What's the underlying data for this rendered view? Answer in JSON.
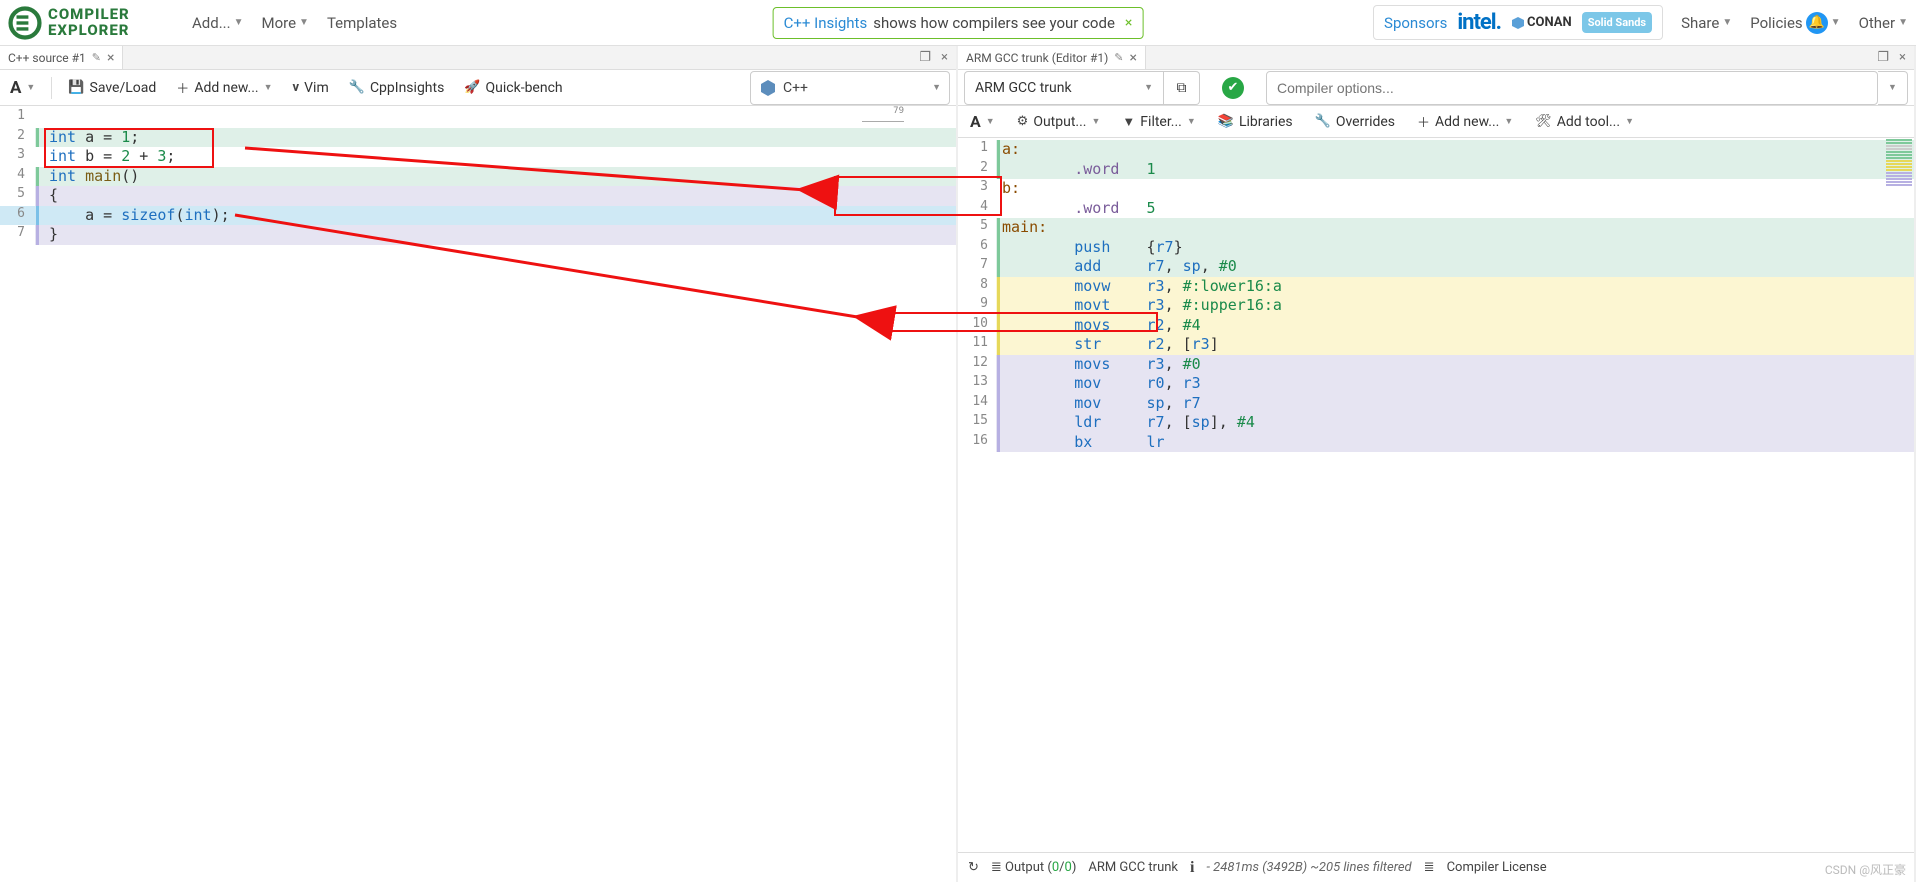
{
  "brand": {
    "line1": "COMPILER",
    "line2": "EXPLORER"
  },
  "nav": {
    "add": "Add...",
    "more": "More",
    "templates": "Templates"
  },
  "banner": {
    "link": "C++ Insights",
    "text": " shows how compilers see your code"
  },
  "navright": {
    "sponsors": "Sponsors",
    "share": "Share",
    "policies": "Policies",
    "other": "Other"
  },
  "sponsor_names": {
    "intel": "intel.",
    "conan": "CONAN",
    "ss": "Solid Sands"
  },
  "left": {
    "tab": "C++ source #1",
    "toolbar": {
      "save": "Save/Load",
      "addnew": "Add new...",
      "vim": "Vim",
      "cpp": "CppInsights",
      "qb": "Quick-bench"
    },
    "lang": "C++",
    "lines": [
      "1",
      "2",
      "3",
      "4",
      "5",
      "6",
      "7"
    ],
    "ruler": "79"
  },
  "src": {
    "l2_kw": "int",
    "l2_rest": " a = ",
    "l2_num": "1",
    "l2_semi": ";",
    "l3_kw": "int",
    "l3_rest": " b = ",
    "l3_n1": "2",
    "l3_plus": " + ",
    "l3_n2": "3",
    "l3_semi": ";",
    "l4_kw": "int",
    "l4_sp": " ",
    "l4_fn": "main",
    "l4_par": "()",
    "l5": "{",
    "l6_ind": "    ",
    "l6_a": "a",
    "l6_eq": " = ",
    "l6_sz": "sizeof",
    "l6_p1": "(",
    "l6_int": "int",
    "l6_p2": ")",
    "l6_semi": ";",
    "l7": "}"
  },
  "right": {
    "tab": "ARM GCC trunk (Editor #1)",
    "compiler": "ARM GCC trunk",
    "opts_ph": "Compiler options...",
    "subtb": {
      "output": "Output...",
      "filter": "Filter...",
      "libs": "Libraries",
      "over": "Overrides",
      "addnew": "Add new...",
      "addtool": "Add tool..."
    },
    "lines": [
      "1",
      "2",
      "3",
      "4",
      "5",
      "6",
      "7",
      "8",
      "9",
      "10",
      "11",
      "12",
      "13",
      "14",
      "15",
      "16"
    ]
  },
  "asm": {
    "l1": "a:",
    "l2i": "        ",
    "l2d": ".word",
    "l2s": "   ",
    "l2v": "1",
    "l3": "b:",
    "l4i": "        ",
    "l4d": ".word",
    "l4s": "   ",
    "l4v": "5",
    "l5": "main:",
    "l6i": "        ",
    "l6op": "push",
    "l6s": "    ",
    "l6p1": "{",
    "l6r": "r7",
    "l6p2": "}",
    "l7i": "        ",
    "l7op": "add",
    "l7s": "     ",
    "l7r1": "r7",
    "l7c": ", ",
    "l7r2": "sp",
    "l7c2": ", ",
    "l7imm": "#0",
    "l8i": "        ",
    "l8op": "movw",
    "l8s": "    ",
    "l8r": "r3",
    "l8c": ", ",
    "l8i2": "#:lower16:a",
    "l9i": "        ",
    "l9op": "movt",
    "l9s": "    ",
    "l9r": "r3",
    "l9c": ", ",
    "l9i2": "#:upper16:a",
    "l10i": "        ",
    "l10op": "movs",
    "l10s": "    ",
    "l10r": "r2",
    "l10c": ", ",
    "l10imm": "#4",
    "l11i": "        ",
    "l11op": "str",
    "l11s": "     ",
    "l11r": "r2",
    "l11c": ", ",
    "l11b1": "[",
    "l11r2": "r3",
    "l11b2": "]",
    "l12i": "        ",
    "l12op": "movs",
    "l12s": "    ",
    "l12r": "r3",
    "l12c": ", ",
    "l12imm": "#0",
    "l13i": "        ",
    "l13op": "mov",
    "l13s": "     ",
    "l13r": "r0",
    "l13c": ", ",
    "l13r2": "r3",
    "l14i": "        ",
    "l14op": "mov",
    "l14s": "     ",
    "l14r": "sp",
    "l14c": ", ",
    "l14r2": "r7",
    "l15i": "        ",
    "l15op": "ldr",
    "l15s": "     ",
    "l15r": "r7",
    "l15c": ", ",
    "l15b1": "[",
    "l15r2": "sp",
    "l15b2": "]",
    "l15c2": ", ",
    "l15imm": "#4",
    "l16i": "        ",
    "l16op": "bx",
    "l16s": "      ",
    "l16r": "lr"
  },
  "status": {
    "output": "Output (",
    "z1": "0",
    "slash": "/",
    "z2": "0",
    "cp": ")",
    "compiler": "ARM GCC trunk",
    "timing": "- 2481ms (3492B) ~205 lines filtered",
    "license": "Compiler License"
  },
  "watermark": "CSDN @风正豪"
}
